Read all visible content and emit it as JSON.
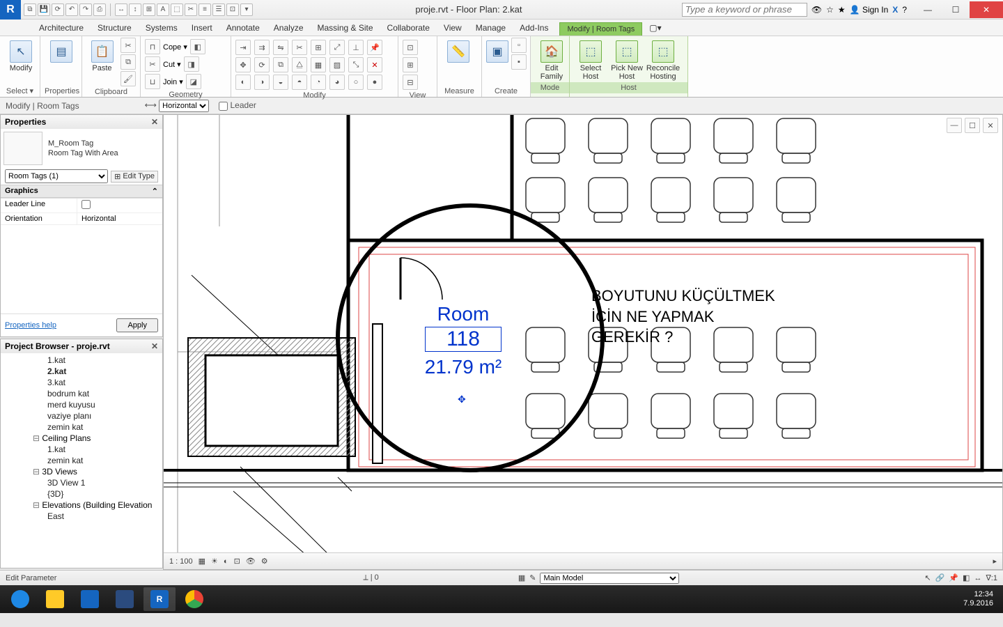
{
  "title": "proje.rvt - Floor Plan: 2.kat",
  "searchPlaceholder": "Type a keyword or phrase",
  "signIn": "Sign In",
  "tabs": [
    "Architecture",
    "Structure",
    "Systems",
    "Insert",
    "Annotate",
    "Analyze",
    "Massing & Site",
    "Collaborate",
    "View",
    "Manage",
    "Add-Ins"
  ],
  "activeContextTab": "Modify | Room Tags",
  "optionsBar": {
    "context": "Modify | Room Tags",
    "orientLabel": "Horizontal",
    "leaderLabel": "Leader"
  },
  "ribbon": {
    "select": "Select ▾",
    "modifyBtn": "Modify",
    "properties": "Properties",
    "clipboard": "Clipboard",
    "paste": "Paste",
    "cope": "Cope ▾",
    "cut": "Cut ▾",
    "join": "Join ▾",
    "geometry": "Geometry",
    "modify": "Modify",
    "view": "View",
    "measure": "Measure",
    "create": "Create",
    "mode": "Mode",
    "host": "Host",
    "editFamily": "Edit\nFamily",
    "selectHost": "Select\nHost",
    "pickNew": "Pick New\nHost",
    "reconcile": "Reconcile\nHosting"
  },
  "propsPanel": {
    "title": "Properties",
    "typeName1": "M_Room Tag",
    "typeName2": "Room Tag With Area",
    "selector": "Room Tags (1)",
    "editType": "Edit Type",
    "sectGraphics": "Graphics",
    "rows": [
      {
        "k": "Leader Line",
        "v": ""
      },
      {
        "k": "Orientation",
        "v": "Horizontal"
      }
    ],
    "helpLink": "Properties help",
    "apply": "Apply"
  },
  "browser": {
    "title": "Project Browser - proje.rvt",
    "items": [
      {
        "t": "1.kat",
        "lvl": 1
      },
      {
        "t": "2.kat",
        "lvl": 1,
        "sel": true
      },
      {
        "t": "3.kat",
        "lvl": 1
      },
      {
        "t": "bodrum kat",
        "lvl": 1
      },
      {
        "t": "merd kuyusu",
        "lvl": 1
      },
      {
        "t": "vaziye planı",
        "lvl": 1
      },
      {
        "t": "zemin kat",
        "lvl": 1
      },
      {
        "t": "Ceiling Plans",
        "grp": true
      },
      {
        "t": "1.kat",
        "lvl": 1
      },
      {
        "t": "zemin kat",
        "lvl": 1
      },
      {
        "t": "3D Views",
        "grp": true
      },
      {
        "t": "3D View 1",
        "lvl": 1
      },
      {
        "t": "{3D}",
        "lvl": 1
      },
      {
        "t": "Elevations (Building Elevation",
        "grp": true
      },
      {
        "t": "East",
        "lvl": 1
      }
    ]
  },
  "viewScale": "1 : 100",
  "status": {
    "left": "Edit Parameter",
    "model": "Main Model"
  },
  "roomTag": {
    "name": "Room",
    "number": "118",
    "area": "21.79 m²"
  },
  "annotation": "BOYUTUNU KÜÇÜLTMEK\nİÇİN NE YAPMAK\nGEREKİR ?",
  "clock": {
    "time": "12:34",
    "date": "7.9.2016"
  }
}
